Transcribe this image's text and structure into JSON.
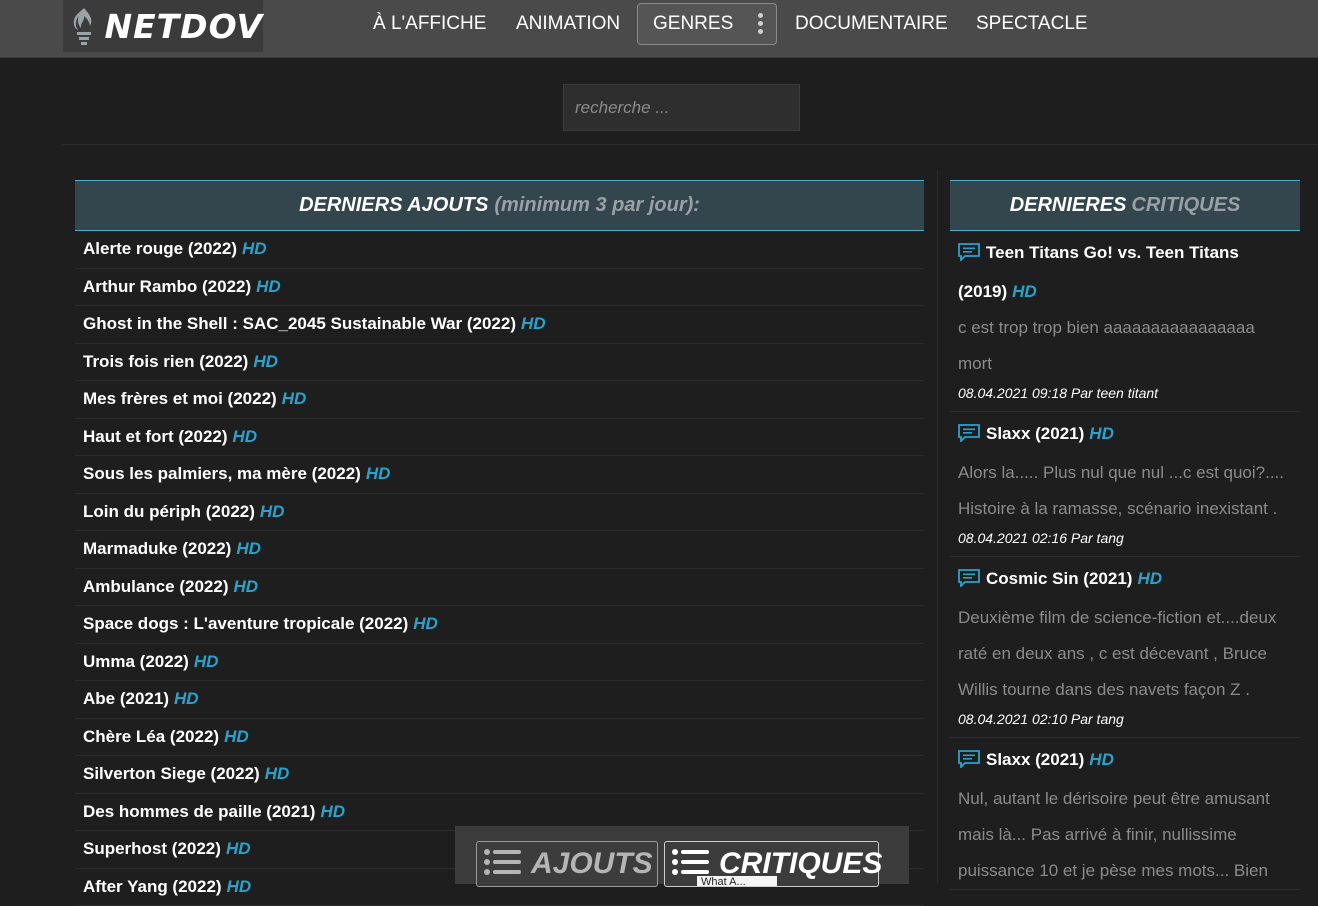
{
  "header": {
    "logo_text": "NETDOV",
    "nav": [
      "À L'AFFICHE",
      "ANIMATION",
      "GENRES",
      "DOCUMENTAIRE",
      "SPECTACLE"
    ]
  },
  "search": {
    "placeholder": "recherche ..."
  },
  "latest": {
    "title": "DERNIERS AJOUTS",
    "subtitle": "(minimum 3 par jour):",
    "badge": "HD",
    "items": [
      "Alerte rouge (2022)",
      "Arthur Rambo (2022)",
      "Ghost in the Shell : SAC_2045 Sustainable War (2022)",
      "Trois fois rien (2022)",
      "Mes frères et moi (2022)",
      "Haut et fort (2022)",
      "Sous les palmiers, ma mère (2022)",
      "Loin du périph (2022)",
      "Marmaduke (2022)",
      "Ambulance (2022)",
      "Space dogs : L'aventure tropicale (2022)",
      "Umma (2022)",
      "Abe (2021)",
      "Chère Léa (2022)",
      "Silverton Siege (2022)",
      "Des hommes de paille (2021)",
      "Superhost (2022)",
      "After Yang (2022)"
    ]
  },
  "reviews": {
    "title_a": "DERNIERES",
    "title_b": "CRITIQUES",
    "badge": "HD",
    "items": [
      {
        "title": "Teen Titans Go! vs. Teen Titans (2019)",
        "text": "c est trop trop bien aaaaaaaaaaaaaaaa mort",
        "meta": "08.04.2021 09:18 Par teen titant"
      },
      {
        "title": "Slaxx (2021)",
        "text": "Alors la..... Plus nul que nul ...c est quoi?.... Histoire à la ramasse, scénario inexistant .",
        "meta": "08.04.2021 02:16 Par tang"
      },
      {
        "title": "Cosmic Sin (2021)",
        "text": "Deuxième film de science-fiction et....deux raté en deux ans , c est décevant , Bruce Willis tourne dans des navets façon Z .",
        "meta": "08.04.2021 02:10 Par tang"
      },
      {
        "title": "Slaxx (2021)",
        "text": "Nul, autant le dérisoire peut être amusant mais là... Pas arrivé à finir, nullissime puissance 10 et je pèse mes mots... Bien",
        "meta": ""
      }
    ]
  },
  "bottom": {
    "ajouts": "AJOUTS",
    "critiques": "CRITIQUES",
    "tooltip": "What A..."
  },
  "colors": {
    "accent": "#2aa3cc",
    "header_bg": "#4a4a4a",
    "panel_head": "#33454d",
    "page_bg": "#1e1e1e"
  }
}
